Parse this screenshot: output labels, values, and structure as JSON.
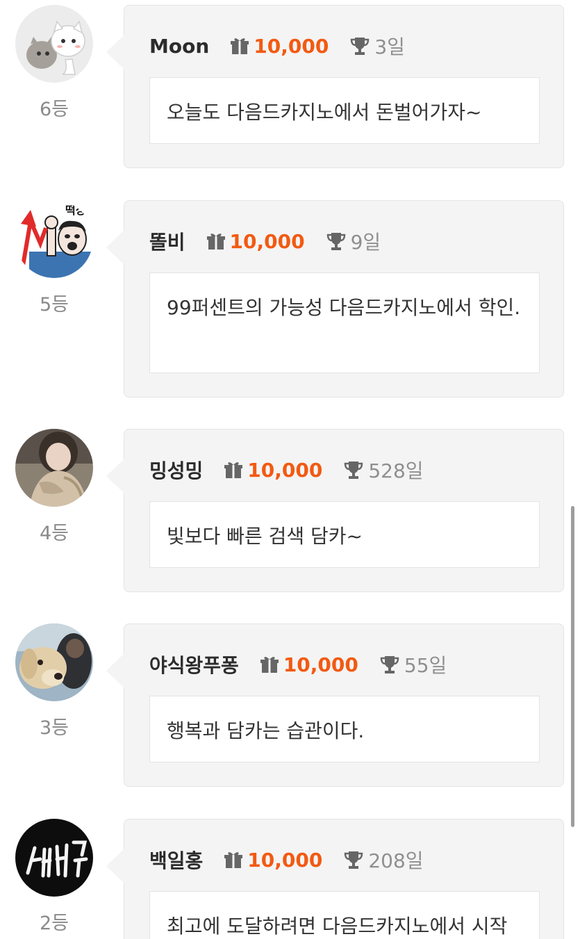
{
  "comments": [
    {
      "nickname": "Moon",
      "points": "10,000",
      "days": "3일",
      "rank": "6등",
      "message": "오늘도 다음드카지노에서 돈벌어가자~",
      "avatar": "avatar-cats"
    },
    {
      "nickname": "똘비",
      "points": "10,000",
      "days": "9일",
      "rank": "5등",
      "message": "99퍼센트의 가능성 다음드카지노에서 학인.",
      "avatar": "avatar-stock-meme",
      "avatar_caption": "떡상"
    },
    {
      "nickname": "밍성밍",
      "points": "10,000",
      "days": "528일",
      "rank": "4등",
      "message": "빛보다 빠른 검색 담카~",
      "avatar": "avatar-photo-person"
    },
    {
      "nickname": "야식왕푸퐁",
      "points": "10,000",
      "days": "55일",
      "rank": "3등",
      "message": "행복과 담카는 습관이다.",
      "avatar": "avatar-dog-photo"
    },
    {
      "nickname": "백일홍",
      "points": "10,000",
      "days": "208일",
      "rank": "2등",
      "message": "최고에 도달하려면 다음드카지노에서 시작",
      "avatar": "avatar-neon-sign"
    }
  ],
  "colors": {
    "points": "#f25a12",
    "nickname": "#2c2c2c",
    "meta": "#8f8f8f",
    "card": "#f4f4f4"
  }
}
